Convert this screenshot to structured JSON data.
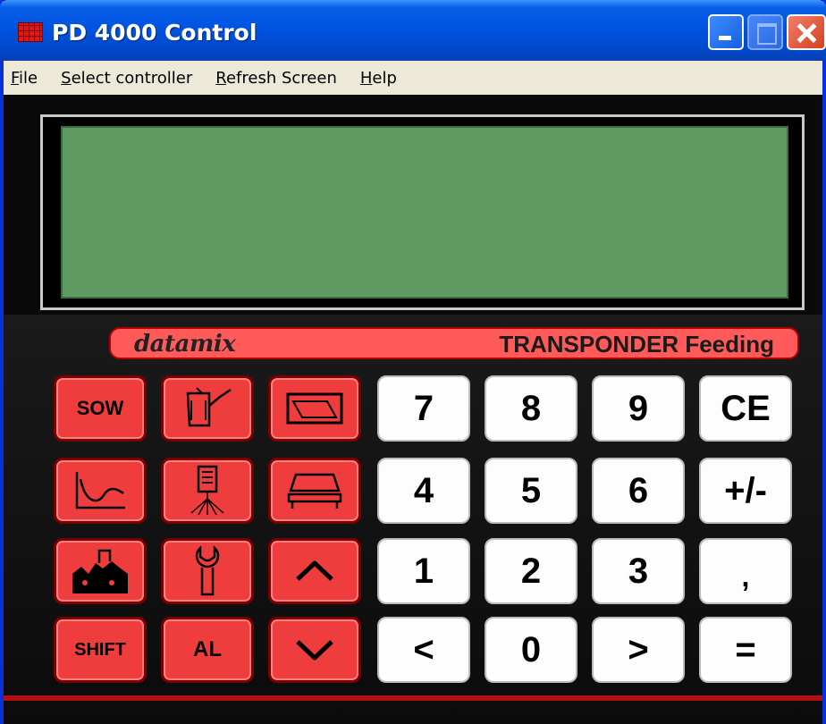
{
  "window": {
    "title": "PD 4000 Control"
  },
  "menu": [
    {
      "underlined": "F",
      "rest": "ile"
    },
    {
      "underlined": "S",
      "rest": "elect controller"
    },
    {
      "underlined": "R",
      "rest": "efresh Screen"
    },
    {
      "underlined": "H",
      "rest": "elp"
    }
  ],
  "lcd": {
    "text": "",
    "color": "#5e9a62"
  },
  "brand": {
    "logo": "datamix",
    "product": "TRANSPONDER Feeding",
    "color": "#ff5a5a"
  },
  "keys": {
    "sow": "SOW",
    "shift": "SHIFT",
    "al": "AL",
    "digits": {
      "seven": "7",
      "eight": "8",
      "nine": "9",
      "ce": "CE",
      "four": "4",
      "five": "5",
      "six": "6",
      "plus_minus": "+/-",
      "one": "1",
      "two": "2",
      "three": "3",
      "comma": ",",
      "less": "<",
      "zero": "0",
      "greater": ">",
      "equals": "="
    },
    "icons": {
      "feeder": "feeder-icon",
      "display": "display-icon",
      "curve": "curve-icon",
      "dispenser": "dispenser-icon",
      "bed": "bed-icon",
      "barn": "barn-icon",
      "wrench": "wrench-icon",
      "up": "chevron-up-icon",
      "down": "chevron-down-icon"
    }
  },
  "colors": {
    "titlebar": "#0054e3",
    "menubar": "#ece9d8",
    "red_key": "#ef3d3d",
    "white_key": "#fdfdfd"
  }
}
